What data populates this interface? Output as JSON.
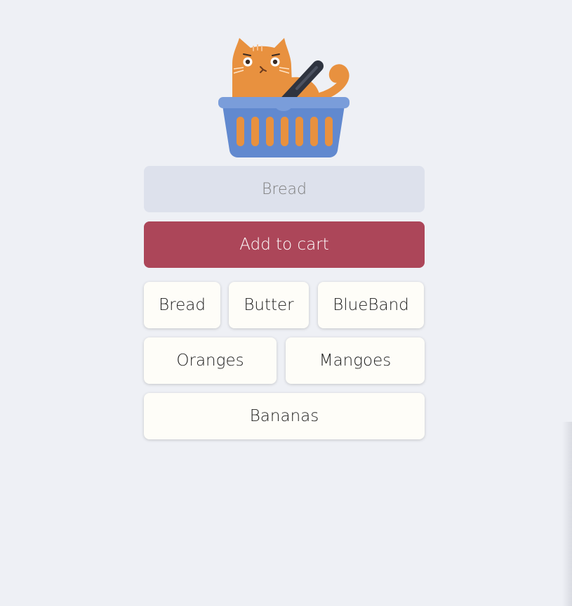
{
  "logo": {
    "name": "cat-in-basket-logo"
  },
  "cart_input": {
    "placeholder": "Bread",
    "value": ""
  },
  "add_button": {
    "label": "Add to cart"
  },
  "items": [
    {
      "label": "Bread"
    },
    {
      "label": "Butter"
    },
    {
      "label": "BlueBand"
    },
    {
      "label": "Oranges"
    },
    {
      "label": "Mangoes"
    },
    {
      "label": "Bananas"
    }
  ],
  "colors": {
    "background": "#eef0f5",
    "input_bg": "#dde1ec",
    "button_bg": "#ac4659",
    "item_bg": "#fefdf8",
    "cat_orange": "#e8913f",
    "basket_blue": "#6189cf"
  }
}
